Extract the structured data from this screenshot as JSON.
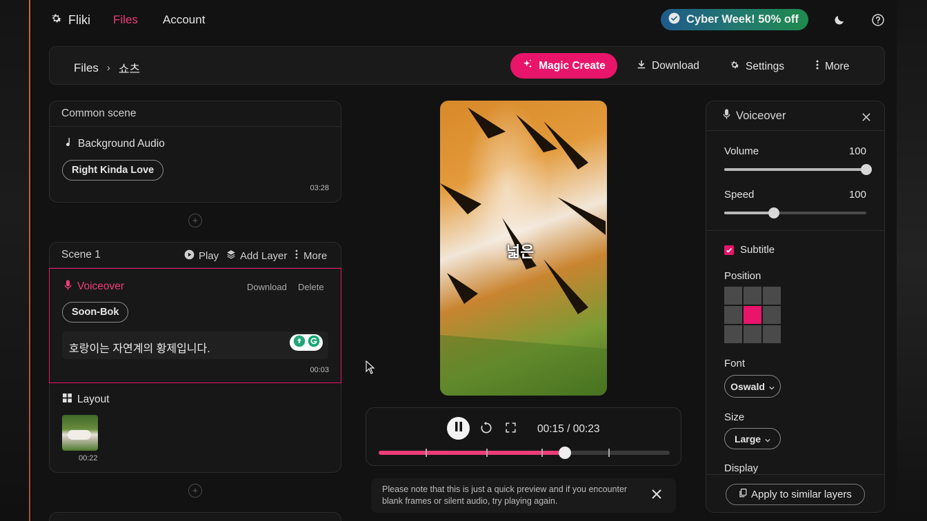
{
  "nav": {
    "brand": "Fliki",
    "files": "Files",
    "account": "Account",
    "promo": "Cyber Week! 50% off"
  },
  "toolbar": {
    "crumb_root": "Files",
    "crumb_sep": "›",
    "crumb_current": "쇼츠",
    "magic_create": "Magic Create",
    "download": "Download",
    "settings": "Settings",
    "more": "More"
  },
  "common_scene": {
    "title": "Common scene",
    "bg_audio_label": "Background Audio",
    "track_name": "Right Kinda Love",
    "duration": "03:28"
  },
  "scene1": {
    "title": "Scene 1",
    "play": "Play",
    "add_layer": "Add Layer",
    "more": "More",
    "voiceover_label": "Voiceover",
    "download": "Download",
    "delete": "Delete",
    "voice_name": "Soon-Bok",
    "script_text": "호랑이는 자연계의 황제입니다.",
    "voice_duration": "00:03",
    "layout_label": "Layout",
    "layout_duration": "00:22"
  },
  "preview": {
    "caption": "넓은"
  },
  "player": {
    "time": "00:15 / 00:23",
    "progress": 0.64,
    "ticks": [
      0.16,
      0.37,
      0.56,
      0.79
    ]
  },
  "notice": {
    "text": "Please note that this is just a quick preview and if you encounter blank frames or silent audio, try playing again."
  },
  "voiceover_panel": {
    "title": "Voiceover",
    "volume_label": "Volume",
    "volume_value": "100",
    "volume_level": 1.0,
    "speed_label": "Speed",
    "speed_value": "100",
    "speed_level": 0.35,
    "subtitle_label": "Subtitle",
    "subtitle_checked": true,
    "position_label": "Position",
    "position_selected": "center",
    "font_label": "Font",
    "font_value": "Oswald",
    "size_label": "Size",
    "size_value": "Large",
    "display_label": "Display",
    "apply_label": "Apply to similar layers"
  },
  "colors": {
    "accent": "#e8156a",
    "active_nav": "#ec3d79",
    "panel": "#171717",
    "background": "#121212"
  }
}
